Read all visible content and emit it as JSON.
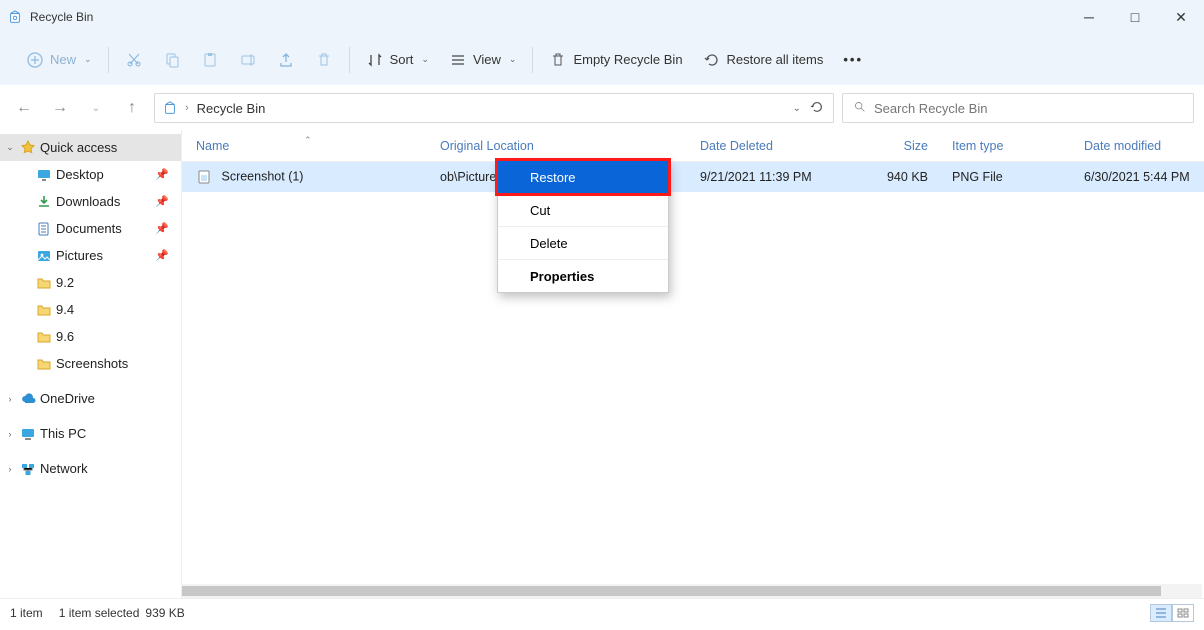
{
  "window": {
    "title": "Recycle Bin"
  },
  "toolbar": {
    "new_label": "New",
    "sort_label": "Sort",
    "view_label": "View",
    "empty_label": "Empty Recycle Bin",
    "restore_all_label": "Restore all items"
  },
  "breadcrumb": {
    "segment": "Recycle Bin"
  },
  "search": {
    "placeholder": "Search Recycle Bin"
  },
  "sidebar": {
    "quick_access": "Quick access",
    "items": [
      {
        "label": "Desktop"
      },
      {
        "label": "Downloads"
      },
      {
        "label": "Documents"
      },
      {
        "label": "Pictures"
      },
      {
        "label": "9.2"
      },
      {
        "label": "9.4"
      },
      {
        "label": "9.6"
      },
      {
        "label": "Screenshots"
      }
    ],
    "onedrive": "OneDrive",
    "thispc": "This PC",
    "network": "Network"
  },
  "columns": {
    "name": "Name",
    "original_location": "Original Location",
    "date_deleted": "Date Deleted",
    "size": "Size",
    "item_type": "Item type",
    "date_modified": "Date modified"
  },
  "rows": [
    {
      "name": "Screenshot (1)",
      "original_location": "ob\\Pictures\\Screenshots\\New f...",
      "date_deleted": "9/21/2021 11:39 PM",
      "size": "940 KB",
      "item_type": "PNG File",
      "date_modified": "6/30/2021 5:44 PM"
    }
  ],
  "context_menu": {
    "restore": "Restore",
    "cut": "Cut",
    "delete": "Delete",
    "properties": "Properties"
  },
  "status": {
    "item_count": "1 item",
    "selected": "1 item selected",
    "size": "939 KB"
  }
}
